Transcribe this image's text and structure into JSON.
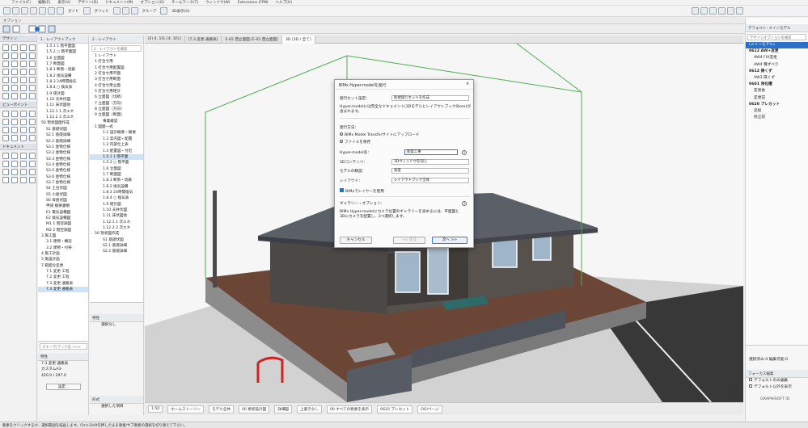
{
  "menubar": {
    "items": [
      "ファイル(F)",
      "編集(E)",
      "表示(V)",
      "デザイン(D)",
      "ドキュメント(M)",
      "オプション(O)",
      "チームワーク(T)",
      "ウィンドウ(W)",
      "Extensions (FPN)",
      "ヘルプ(H)"
    ]
  },
  "toolbar": {
    "guide_label": "ガイド",
    "grid_label": "グリッド",
    "group_label": "グループ",
    "view_mode": "3D表示(G)"
  },
  "subbar": {
    "label": "オプション"
  },
  "toolbox": {
    "design_header": "デザイン",
    "viewpoint_header": "ビューポイント",
    "document_header": "ドキュメント"
  },
  "navigator1": {
    "header": "1 - レイアウトブック",
    "items": [
      "1.5.1 1 階平面図",
      "1.5.2 ○ 階平面図",
      "1.6 立面図",
      "1.7 断面図",
      "1.8.1 断熱・遮蔽",
      "1.8.2 換気設備",
      "1.8.3 24時間換気",
      "1.8.4 ○ 換気表",
      "1.9 矩計図",
      "1.10 天井伏図",
      "1.11 床伏図他",
      "1.12.1 1 次エネ",
      "1.12.2 2 次エネ",
      "50 現状図面作成",
      "S1 基礎伏図",
      "S2.1 基礎詳細",
      "S2.2 基礎詳細",
      "S3.1 金物仕様",
      "S3.2 金物仕様",
      "S3.3 金物仕様",
      "S3.4 金物仕様",
      "S3.5 金物仕様",
      "S3.6 金物仕様",
      "S3.7 金物仕様",
      "S4 土台伏図",
      "S5 小屋伏図",
      "S6 母屋伏図",
      "申請 概要書類",
      "E1 電気設備図",
      "E2 換気設備図",
      "M1 1 階空調図",
      "M2 2 階空調図",
      "3 施工図",
      "3.1 建物・構造",
      "3.2 建物・付帯",
      "4 施工計画",
      "5 施設計画",
      "7 範囲な変更",
      "7.1 変更 工程",
      "7.2 変更 工程",
      "7.3 変更 通路表",
      "7.4 変更 通路表"
    ],
    "selected_index": 41,
    "search_placeholder": "スキーマ/ブック名 >>>",
    "prop_header": "特性",
    "prop_row1_label": "7.3",
    "prop_row1_value": "変更 通路表",
    "prop_row2_label": "カスタムA3-",
    "prop_row3_value": "420.0 / 297.0",
    "settings_button": "設定..."
  },
  "navigator2": {
    "header": "2 - レイアウト",
    "search_placeholder": "2 - レイアウトを検索",
    "items": [
      "1 レイアウト",
      "1 打合せ用",
      "1 打合せ用配置図",
      "2 打合せ用平面",
      "3 打合せ用断面",
      "4 打合せ用立面",
      "5 打合せ用矩計",
      "6 立面図（切断）",
      "7 立面図（方向）",
      "8 立面図（方向）",
      "9 立面図（断面）",
      "事業確認",
      "1 図面一式",
      "1.1 設計概要・概要",
      "1.2 案内図・配置",
      "1.3 内部仕上表",
      "1.4 配置図・付近",
      "1.5.1 1 階平面",
      "1.5.2 ○ 階平面",
      "1.6 立面図",
      "1.7 断面図",
      "1.8.1 断熱・遮蔽",
      "1.8.2 換気設備",
      "1.8.3 24時間換気",
      "1.8.4 ○ 換気表",
      "1.9 矩計図",
      "1.10 天井伏図",
      "1.11 床伏図他",
      "1.12.1 1 次エネ",
      "1.12.2 2 次エネ",
      "50 現状図作成",
      "S1 基礎伏図",
      "S2.1 基礎詳細",
      "S2.2 基礎詳細"
    ],
    "selected_index": 17,
    "prop_header": "特性",
    "prop_value": "選択なし",
    "bottom_header": "形式",
    "bottom_value": "選択した項目"
  },
  "viewport_tabs": [
    "(F) 4. 1FL [4. 1FL]",
    "[7.3 変更 通路表]",
    "E-02 西立面図 [E-02 西立面図]",
    "3D [3D / 全て]"
  ],
  "active_tab_index": 3,
  "dialog": {
    "title": "BIMx Hyper-modelを発行",
    "publish_set_label": "発行セット設定：",
    "publish_set_value": "新規発行セットを作成",
    "desc": "Hyper-modelには完全なドキュメント(3DモデルとレイアウトブックStore)が含まれます。",
    "method_header": "発行方法：",
    "method_opt1": "BIMx Model Transferサイトにアップロード",
    "method_opt2": "ファイルを保存",
    "name_label": "Hyper-model名：",
    "name_value": "新築工事",
    "content_label": "3Dコンテンツ：",
    "content_value": "3Dウィンドウを同じ",
    "detail_label": "モデルの精度：",
    "detail_value": "高度",
    "layout_label": "レイアウト：",
    "layout_value": "レイアウトブック全体",
    "checkbox_label": "BIMxでレイヤーを使用",
    "gallery_header": "ギャラリー・オプション：",
    "gallery_desc": "BIMx Hyper-modelにカメラ位置のギャラリーを含めるには、平面図と3Dにカメラを配置し、3つ選択します。",
    "cancel_button": "キャンセル",
    "back_button": "<< 戻る",
    "next_button": "次へ >>",
    "help_icon": "?",
    "close_icon": "×"
  },
  "statusbar": {
    "items": [
      "1:50",
      "ホームストーリー",
      "モデル全体",
      "00 更新設計図",
      "詳細図",
      "上書きなし",
      "00 すべての要素を表示",
      "0620 プレカット",
      "OG/ページ"
    ]
  },
  "rightpanel": {
    "header": "デフォルト: メインモデル",
    "search_placeholder": "デザインオプションを検索",
    "items": [
      {
        "label": "(メインモデル)",
        "kind": "sel"
      },
      {
        "label": "0612 AW+変更",
        "kind": "grp"
      },
      {
        "label": "AW4 FIX変更",
        "kind": "sub"
      },
      {
        "label": "AW4 種ずべり",
        "kind": "sub"
      },
      {
        "label": "0612 掃くず",
        "kind": "grp"
      },
      {
        "label": "AW3 掃くず",
        "kind": "sub"
      },
      {
        "label": "0601 浄化槽",
        "kind": "grp"
      },
      {
        "label": "変更後",
        "kind": "sub"
      },
      {
        "label": "変更前",
        "kind": "sub"
      },
      {
        "label": "0620 プレカット",
        "kind": "grp"
      },
      {
        "label": "追加",
        "kind": "sub"
      },
      {
        "label": "修正前",
        "kind": "sub"
      }
    ],
    "edit_label": "選択済み:0 編集可能:0",
    "focus_header": "フォーカス編集",
    "focus_opt1": "デフォルトのみ編集",
    "focus_opt2": "デフォルト以外を表示",
    "brand": "GRAPHISOFT ID"
  },
  "bottombar": {
    "hint": "要素をクリックするか、選択範囲を描画します。Ctrl+Shiftを押したまま要素/サブ要素の選択を切り替えて下さい。"
  },
  "colors": {
    "accent": "#2a6fc9",
    "guide": "#4caf50",
    "roof": "#5b5f66",
    "wall": "#4b4845"
  }
}
